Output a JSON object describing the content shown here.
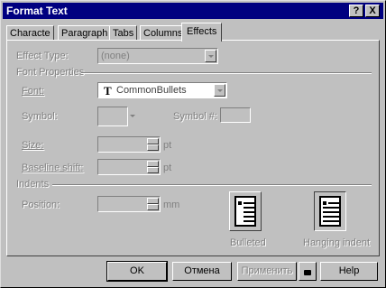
{
  "window": {
    "title": "Format Text",
    "help_label": "?",
    "close_label": "X"
  },
  "tabs": [
    "Characte",
    "Paragraph",
    "Tabs",
    "Columns",
    "Effects"
  ],
  "effect_type": {
    "label": "Effect Type:",
    "value": "(none)"
  },
  "font_properties": {
    "label": "Font Properties"
  },
  "font": {
    "label": "Font:",
    "value": "CommonBullets",
    "icon": "truetype-icon"
  },
  "symbol": {
    "label": "Symbol:",
    "number_label": "Symbol #:",
    "number_value": ""
  },
  "size": {
    "label": "Size:",
    "value": "",
    "unit": "pt"
  },
  "baseline": {
    "label": "Baseline shift:",
    "value": "",
    "unit": "pt"
  },
  "indents": {
    "label": "Indents"
  },
  "position": {
    "label": "Position:",
    "value": "",
    "unit": "mm"
  },
  "styles": {
    "bulleted": "Bulleted",
    "hanging": "Hanging indent"
  },
  "buttons": {
    "ok": "OK",
    "cancel": "Отмена",
    "apply": "Применить",
    "help": "Help"
  }
}
